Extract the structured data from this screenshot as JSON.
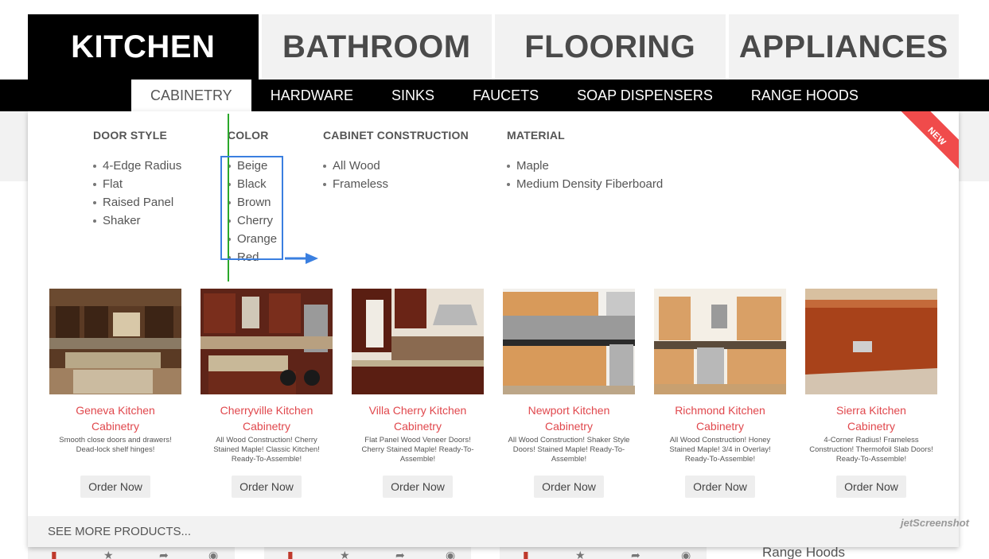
{
  "main_tabs": [
    {
      "label": "KITCHEN",
      "active": true
    },
    {
      "label": "BATHROOM",
      "active": false
    },
    {
      "label": "FLOORING",
      "active": false
    },
    {
      "label": "APPLIANCES",
      "active": false
    }
  ],
  "sub_nav": [
    {
      "label": "CABINETRY",
      "active": true
    },
    {
      "label": "HARDWARE",
      "active": false
    },
    {
      "label": "SINKS",
      "active": false
    },
    {
      "label": "FAUCETS",
      "active": false
    },
    {
      "label": "SOAP DISPENSERS",
      "active": false
    },
    {
      "label": "RANGE HOODS",
      "active": false
    }
  ],
  "filters": {
    "door_style": {
      "heading": "DOOR STYLE",
      "items": [
        "4-Edge Radius",
        "Flat",
        "Raised Panel",
        "Shaker"
      ]
    },
    "color": {
      "heading": "COLOR",
      "items": [
        "Beige",
        "Black",
        "Brown",
        "Cherry",
        "Orange",
        "Red"
      ]
    },
    "construction": {
      "heading": "CABINET CONSTRUCTION",
      "items": [
        "All Wood",
        "Frameless"
      ]
    },
    "material": {
      "heading": "MATERIAL",
      "items": [
        "Maple",
        "Medium Density Fiberboard"
      ]
    }
  },
  "ribbon": {
    "label": "NEW",
    "icon": "star-icon"
  },
  "products": [
    {
      "name_line1": "Geneva Kitchen",
      "name_line2": "Cabinetry",
      "desc": "Smooth close doors and drawers! Dead-lock shelf hinges!",
      "button": "Order Now"
    },
    {
      "name_line1": "Cherryville Kitchen",
      "name_line2": "Cabinetry",
      "desc": "All Wood Construction! Cherry Stained Maple! Classic Kitchen! Ready-To-Assemble!",
      "button": "Order Now"
    },
    {
      "name_line1": "Villa Cherry Kitchen",
      "name_line2": "Cabinetry",
      "desc": "Flat Panel Wood Veneer Doors! Cherry Stained Maple! Ready-To-Assemble!",
      "button": "Order Now"
    },
    {
      "name_line1": "Newport Kitchen",
      "name_line2": "Cabinetry",
      "desc": "All Wood Construction! Shaker Style Doors! Stained Maple! Ready-To-Assemble!",
      "button": "Order Now"
    },
    {
      "name_line1": "Richmond Kitchen",
      "name_line2": "Cabinetry",
      "desc": "All Wood Construction! Honey Stained Maple! 3/4 in Overlay! Ready-To-Assemble!",
      "button": "Order Now"
    },
    {
      "name_line1": "Sierra Kitchen",
      "name_line2": "Cabinetry",
      "desc": "4-Corner Radius! Frameless Construction! Thermofoil Slab Doors! Ready-To-Assemble!",
      "button": "Order Now"
    }
  ],
  "see_more": "SEE MORE PRODUCTS...",
  "below": {
    "range_hoods": "Range Hoods"
  },
  "watermark": "jetScreenshot",
  "colors": {
    "accent_red": "#e0474c",
    "ribbon_red": "#f04b4b",
    "annotation_blue": "#3a7fe0",
    "annotation_green": "#2aa82a",
    "nav_black": "#000000"
  }
}
